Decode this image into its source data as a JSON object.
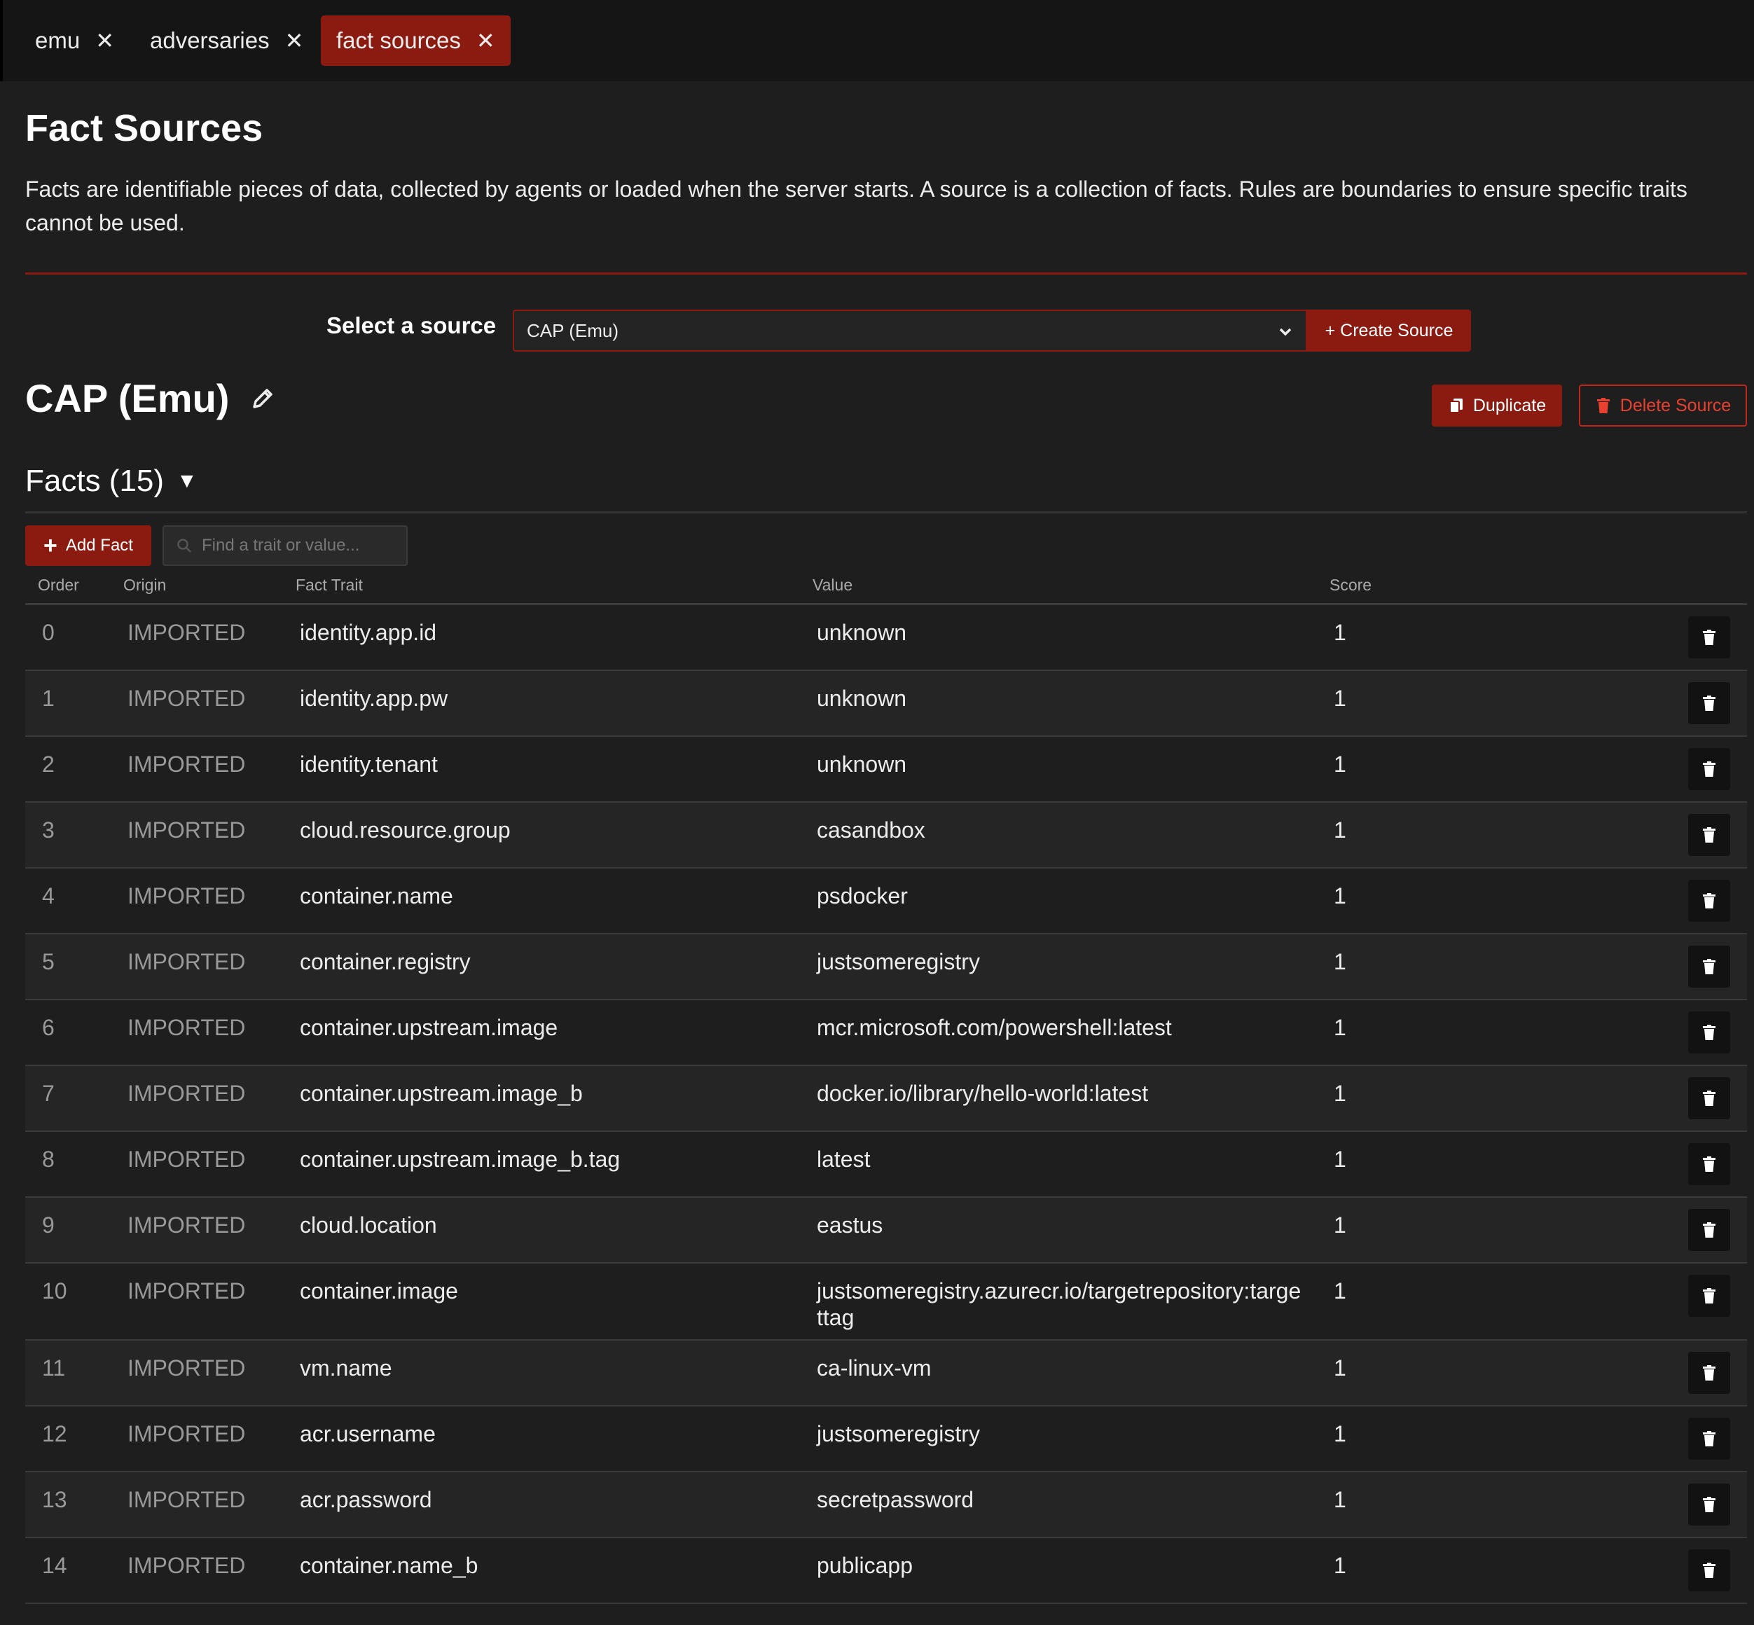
{
  "tabs": [
    {
      "label": "emu",
      "active": false
    },
    {
      "label": "adversaries",
      "active": false
    },
    {
      "label": "fact sources",
      "active": true
    }
  ],
  "page": {
    "title": "Fact Sources",
    "description": "Facts are identifiable pieces of data, collected by agents or loaded when the server starts. A source is a collection of facts. Rules are boundaries to ensure specific traits cannot be used."
  },
  "source_select": {
    "label": "Select a source",
    "selected": "CAP (Emu)",
    "create_label": "+ Create Source"
  },
  "source": {
    "title": "CAP (Emu)",
    "duplicate_label": "Duplicate",
    "delete_label": "Delete Source"
  },
  "facts": {
    "header": "Facts (15)",
    "add_label": "Add Fact",
    "search_placeholder": "Find a trait or value...",
    "columns": [
      "Order",
      "Origin",
      "Fact Trait",
      "Value",
      "Score"
    ],
    "rows": [
      {
        "order": "0",
        "origin": "IMPORTED",
        "trait": "identity.app.id",
        "value": "unknown",
        "score": "1"
      },
      {
        "order": "1",
        "origin": "IMPORTED",
        "trait": "identity.app.pw",
        "value": "unknown",
        "score": "1"
      },
      {
        "order": "2",
        "origin": "IMPORTED",
        "trait": "identity.tenant",
        "value": "unknown",
        "score": "1"
      },
      {
        "order": "3",
        "origin": "IMPORTED",
        "trait": "cloud.resource.group",
        "value": "casandbox",
        "score": "1"
      },
      {
        "order": "4",
        "origin": "IMPORTED",
        "trait": "container.name",
        "value": "psdocker",
        "score": "1"
      },
      {
        "order": "5",
        "origin": "IMPORTED",
        "trait": "container.registry",
        "value": "justsomeregistry",
        "score": "1"
      },
      {
        "order": "6",
        "origin": "IMPORTED",
        "trait": "container.upstream.image",
        "value": "mcr.microsoft.com/powershell:latest",
        "score": "1"
      },
      {
        "order": "7",
        "origin": "IMPORTED",
        "trait": "container.upstream.image_b",
        "value": "docker.io/library/hello-world:latest",
        "score": "1"
      },
      {
        "order": "8",
        "origin": "IMPORTED",
        "trait": "container.upstream.image_b.tag",
        "value": "latest",
        "score": "1"
      },
      {
        "order": "9",
        "origin": "IMPORTED",
        "trait": "cloud.location",
        "value": "eastus",
        "score": "1"
      },
      {
        "order": "10",
        "origin": "IMPORTED",
        "trait": "container.image",
        "value": "justsomeregistry.azurecr.io/targetrepository:targettag",
        "score": "1"
      },
      {
        "order": "11",
        "origin": "IMPORTED",
        "trait": "vm.name",
        "value": "ca-linux-vm",
        "score": "1"
      },
      {
        "order": "12",
        "origin": "IMPORTED",
        "trait": "acr.username",
        "value": "justsomeregistry",
        "score": "1"
      },
      {
        "order": "13",
        "origin": "IMPORTED",
        "trait": "acr.password",
        "value": "secretpassword",
        "score": "1"
      },
      {
        "order": "14",
        "origin": "IMPORTED",
        "trait": "container.name_b",
        "value": "publicapp",
        "score": "1"
      }
    ]
  },
  "colors": {
    "accent": "#8b1a10",
    "danger": "#e8412f",
    "background": "#1e1e1e"
  },
  "icons": {
    "tab_close": "close-icon",
    "edit": "pencil-icon",
    "duplicate": "copy-icon",
    "delete": "trash-icon",
    "add": "plus-icon",
    "search": "search-icon",
    "select": "chevron-down-icon",
    "collapse": "triangle-down-icon"
  }
}
